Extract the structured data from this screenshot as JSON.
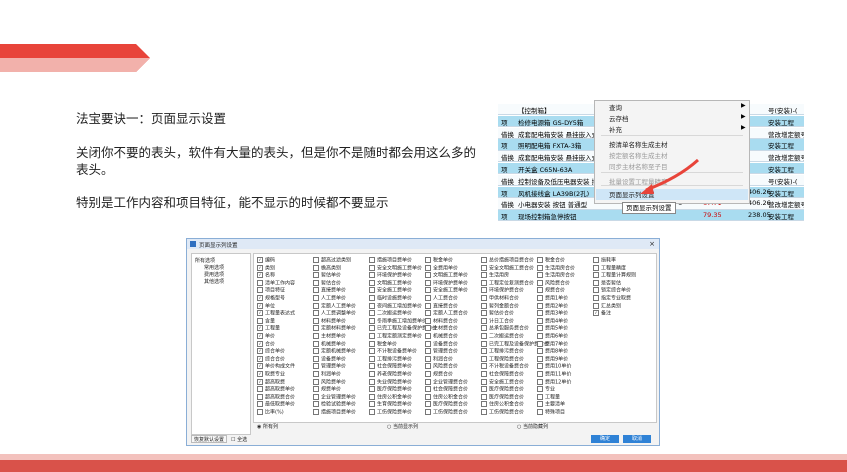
{
  "slide": {
    "line1": "法宝要诀一：页面显示设置",
    "line2": "关闭你不要的表头，软件有大量的表头，但是你不是随时都会用这么多的表头。",
    "line3": "特别是工作内容和项目特征，能不显示的时候都不要显示"
  },
  "screenshot": {
    "rows": [
      {
        "c1": "",
        "c2": "【控制箱】",
        "n1": "",
        "n2": "",
        "n3": "",
        "r": "号(安装)-("
      },
      {
        "c1": "项",
        "c2": "检修电源箱 GS-DY5箱",
        "n1": "",
        "n2": "",
        "n3": "",
        "r": "安装工程"
      },
      {
        "c1": "借换",
        "c2": "成套配电箱安装 悬挂嵌入式",
        "n1": "",
        "n2": "",
        "n3": "",
        "r": "营改增定额号(安装)-("
      },
      {
        "c1": "项",
        "c2": "照明配电箱 FXTA-3箱",
        "n1": "",
        "n2": "",
        "n3": "",
        "r": "安装工程"
      },
      {
        "c1": "借换",
        "c2": "成套配电箱安装 悬挂嵌入式",
        "n1": "",
        "n2": "",
        "n3": "",
        "r": "营改增定额号(安装)-("
      },
      {
        "c1": "项",
        "c2": "开关盒 C65N-63A",
        "n1": "",
        "n2": "",
        "n3": "",
        "r": "安装工程"
      },
      {
        "c1": "借换",
        "c2": "控制设备及低压电器安装 插",
        "n1": "",
        "n2": "",
        "n3": "",
        "r": "号(安装)-("
      },
      {
        "c1": "项",
        "c2": "风机接线盒 LA39B(2孔)",
        "n1": "6",
        "n2": "67.71",
        "n3": "406.26",
        "r": "安装工程"
      },
      {
        "c1": "借换",
        "c2": "小电器安装 按钮 普通型",
        "n1": "6",
        "n2": "67.71",
        "n3": "406.26",
        "r": "营改增定额号(安装)-("
      },
      {
        "c1": "项",
        "c2": "现场控制箱急停按钮",
        "n1": "",
        "n2": "79.35",
        "n3": "238.05",
        "r": "安装工程"
      }
    ],
    "menu": {
      "items": [
        "查询",
        "云存档",
        "补充",
        "按清单名称生成主材",
        "按定额名称生成主材",
        "同步主材名称至子目",
        "批量设置工程量精度",
        "页面显示列设置"
      ],
      "tooltip": "页面显示列设置"
    }
  },
  "dialog": {
    "title": "页面显示列设置",
    "tree": [
      "所有选项",
      "常用选项",
      "费用选项",
      "其他选项"
    ],
    "columns": [
      [
        "编码",
        "类别",
        "名称",
        "清单工作内容",
        "项目特征",
        "规格型号",
        "单位",
        "工程量表达式",
        "含量",
        "工程量",
        "单价",
        "合价",
        "综合单价",
        "综合合价",
        "单价构成文件",
        "取费专业",
        "超高取费",
        "超高取费单价",
        "超高取费合价",
        "最低取费单价",
        "比率(%)"
      ],
      [
        "超高过滤类别",
        "檐高类别",
        "暂估单价",
        "暂估合价",
        "直接费单价",
        "人工费单价",
        "定额人工费单价",
        "人工费调整单价",
        "材料费单价",
        "定额材料费单价",
        "主材费单价",
        "机械费单价",
        "定额机械费单价",
        "设备费单价",
        "管理费单价",
        "利润单价",
        "风险费单价",
        "规费单价",
        "企业管理费单价",
        "检验试验费单价",
        "措施项目费单价"
      ],
      [
        "措施项目费单价",
        "安全文明施工费单价",
        "环境保护费单价",
        "文明施工费单价",
        "安全施工费单价",
        "临时设施费单价",
        "夜间施工增加费单价",
        "二次搬运费单价",
        "冬雨季施工增加费单价",
        "已完工程及设备保护费单价",
        "工程定额测定费单价",
        "税金单价",
        "不计税设备费单价",
        "工程排污费单价",
        "社会保障费单价",
        "养老保险费单价",
        "失业保险费单价",
        "医疗保险费单价",
        "住房公积金单价",
        "生育保险费单价",
        "工伤保险费单价"
      ],
      [
        "税金单价",
        "全费用单价",
        "文明施工费单价",
        "环境保护费单价",
        "安全施工费单价",
        "人工费合价",
        "直接费合价",
        "定额人工费合价",
        "材料费合价",
        "主材费合价",
        "机械费合价",
        "设备费合价",
        "管理费合价",
        "利润合价",
        "风险费合价",
        "规费合价",
        "企业管理费合价",
        "社会保障费合价",
        "住房公积金合价",
        "医疗保险费合价",
        "工伤保险费合价"
      ],
      [
        "总价措施项目费合价",
        "安全文明施工费合价",
        "生活用房",
        "工程定位复测费合价",
        "环境保护费合价",
        "甲供材料合价",
        "暂列金额合价",
        "暂估价合价",
        "计日工合价",
        "总承包服务费合价",
        "二次搬运费合价",
        "已完工程及设备保护费合价",
        "工程排污费合价",
        "工程保险费合价",
        "不计税设备费合价",
        "社会保障费合价",
        "安全施工费合价",
        "医疗保险费合价",
        "医疗保险费合价",
        "住房公积金合价",
        "工伤保险费合价"
      ],
      [
        "税金合价",
        "生活用房合价",
        "生活用房合价",
        "风险费合价",
        "规费合价",
        "费用1单价",
        "费用2单价",
        "费用3单价",
        "费用4单价",
        "费用5单价",
        "费用6单价",
        "费用7单价",
        "费用8单价",
        "费用9单价",
        "费用10单价",
        "费用11单价",
        "费用12单价",
        "专业",
        "工程量",
        "主要清单",
        "特殊项目"
      ],
      [
        "损耗率",
        "工程量精度",
        "工程量计算规则",
        "是否暂估",
        "锁定综合单价",
        "指定专业取费",
        "汇总类别",
        "备注"
      ]
    ],
    "checked": {
      "0": [
        0,
        1,
        2,
        5,
        6,
        7,
        9,
        10,
        11,
        12,
        13,
        14,
        15,
        16
      ],
      "6": [
        7
      ]
    },
    "radios": [
      "所有列",
      "当前显示列",
      "当前隐藏列"
    ],
    "restore_label": "恢复默认设置",
    "all_label": "全选",
    "ok_label": "确定",
    "cancel_label": "取消"
  },
  "colors": {
    "accent": "#e8443a",
    "banner_light": "#f2b1ab",
    "table_blue": "#a9dcf0",
    "dialog_blue": "#2f82d6"
  }
}
